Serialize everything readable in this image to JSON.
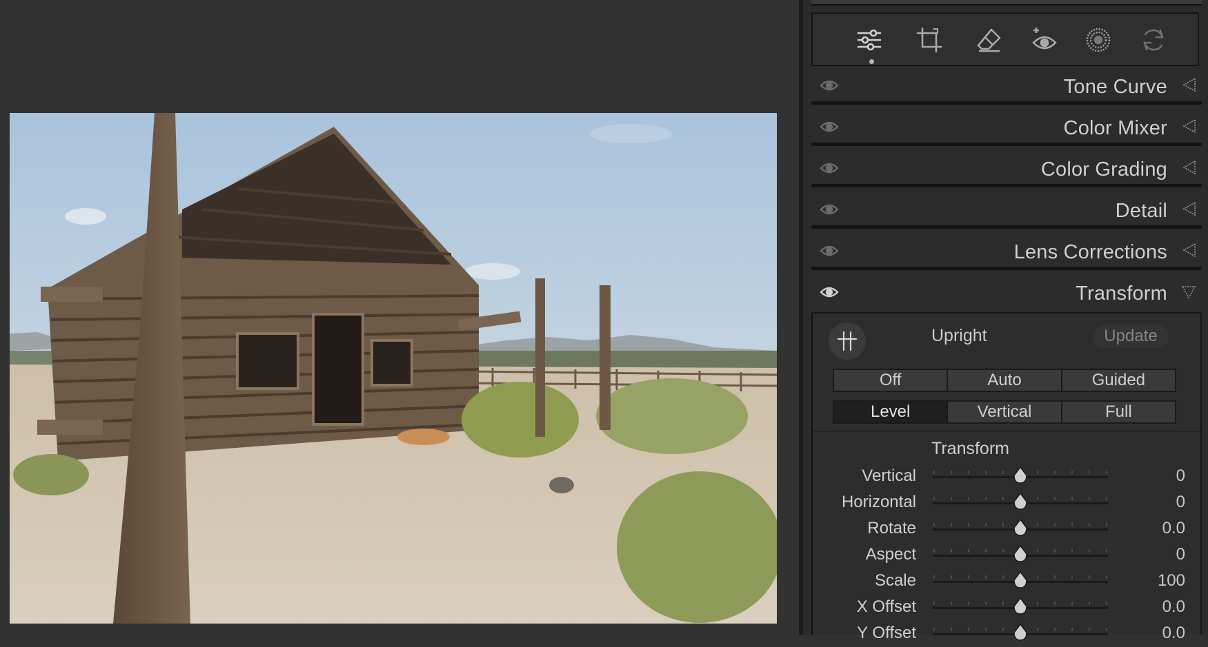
{
  "toolbar": {
    "tools": [
      {
        "icon": "edit-sliders-icon",
        "active": true
      },
      {
        "icon": "crop-icon"
      },
      {
        "icon": "eraser-heal-icon"
      },
      {
        "icon": "red-eye-icon"
      },
      {
        "icon": "masking-icon"
      },
      {
        "icon": "presets-icon"
      }
    ]
  },
  "sections": [
    {
      "title": "Tone Curve",
      "expanded": false
    },
    {
      "title": "Color Mixer",
      "expanded": false
    },
    {
      "title": "Color Grading",
      "expanded": false
    },
    {
      "title": "Detail",
      "expanded": false
    },
    {
      "title": "Lens Corrections",
      "expanded": false
    },
    {
      "title": "Transform",
      "expanded": true
    }
  ],
  "transform": {
    "upright_label": "Upright",
    "update_label": "Update",
    "upright_row1": [
      "Off",
      "Auto",
      "Guided"
    ],
    "upright_row2": [
      "Level",
      "Vertical",
      "Full"
    ],
    "sub_title": "Transform",
    "sliders": [
      {
        "label": "Vertical",
        "value": "0",
        "position": 0.5
      },
      {
        "label": "Horizontal",
        "value": "0",
        "position": 0.5
      },
      {
        "label": "Rotate",
        "value": "0.0",
        "position": 0.5
      },
      {
        "label": "Aspect",
        "value": "0",
        "position": 0.5
      },
      {
        "label": "Scale",
        "value": "100",
        "position": 0.5
      },
      {
        "label": "X Offset",
        "value": "0.0",
        "position": 0.5
      },
      {
        "label": "Y Offset",
        "value": "0.0",
        "position": 0.5
      }
    ]
  },
  "colors": {
    "background": "#323232",
    "panel": "#2b2b2b",
    "text": "#cfcfcf"
  }
}
